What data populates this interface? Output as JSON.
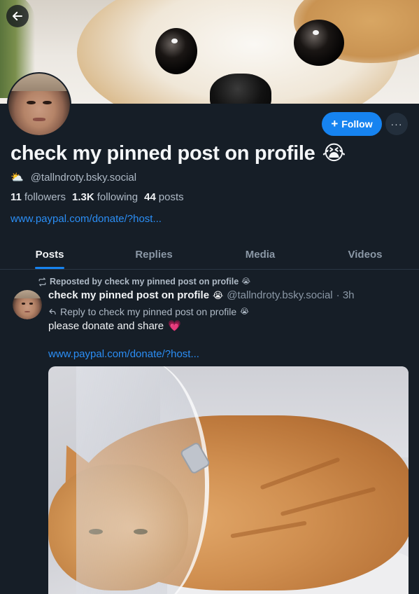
{
  "banner": {
    "back_label": "Back"
  },
  "profile": {
    "display_name": "check my pinned post on profile",
    "display_name_emoji": "😭",
    "handle_emoji": "⛅",
    "handle": "@tallndroty.bsky.social",
    "followers_count": "11",
    "followers_label": "followers",
    "following_count": "1.3K",
    "following_label": "following",
    "posts_count": "44",
    "posts_label": "posts",
    "link": "www.paypal.com/donate/?host..."
  },
  "actions": {
    "follow_label": "Follow",
    "more_label": "···"
  },
  "tabs": [
    {
      "label": "Posts"
    },
    {
      "label": "Replies"
    },
    {
      "label": "Media"
    },
    {
      "label": "Videos"
    }
  ],
  "post": {
    "repost_label": "Reposted by check my pinned post on profile",
    "author_name": "check my pinned post on profile",
    "author_handle": "@tallndroty.bsky.social",
    "time": "· 3h",
    "reply_label": "Reply to check my pinned post on profile",
    "text": "please donate and share",
    "heart": "💗",
    "link": "www.paypal.com/donate/?host...",
    "emoji": "😭"
  },
  "colors": {
    "accent": "#1683f0",
    "link": "#2b8ef5",
    "background": "#161e27"
  },
  "icons": [
    "back-arrow-icon",
    "plus-icon",
    "more-icon",
    "repost-icon",
    "reply-icon"
  ]
}
